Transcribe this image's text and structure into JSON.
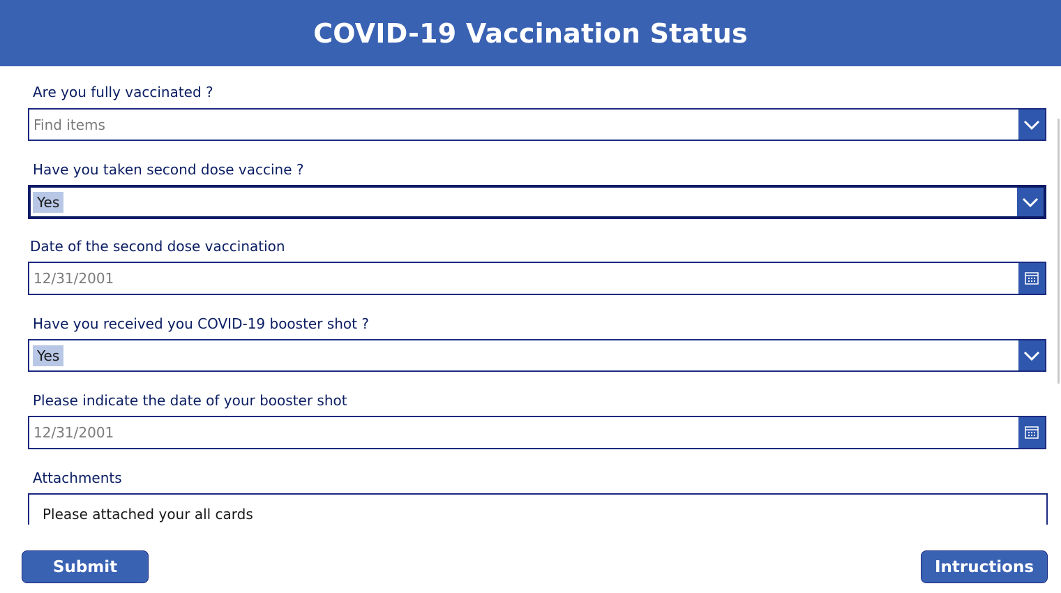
{
  "header": {
    "title": "COVID-19 Vaccination Status"
  },
  "form": {
    "fully_vaccinated": {
      "label": "Are you fully vaccinated ?",
      "placeholder": "Find items"
    },
    "second_dose": {
      "label": "Have you taken second dose vaccine ?",
      "selected": "Yes"
    },
    "second_dose_date": {
      "label": "Date of the second dose vaccination",
      "value": "12/31/2001"
    },
    "booster": {
      "label": "Have you received you COVID-19  booster shot ?",
      "selected": "Yes"
    },
    "booster_date": {
      "label": "Please indicate the date of your booster shot",
      "value": "12/31/2001"
    },
    "attachments": {
      "label": "Attachments",
      "text": "Please attached your all cards"
    }
  },
  "footer": {
    "submit_label": "Submit",
    "instructions_label": "Intructions"
  },
  "colors": {
    "header": "#3a62b3",
    "button": "#3a62b3",
    "border": "#1c2a80",
    "chip": "#b8c7e6"
  },
  "icons": {
    "dropdown": "chevron-down-icon",
    "date": "calendar-icon"
  }
}
